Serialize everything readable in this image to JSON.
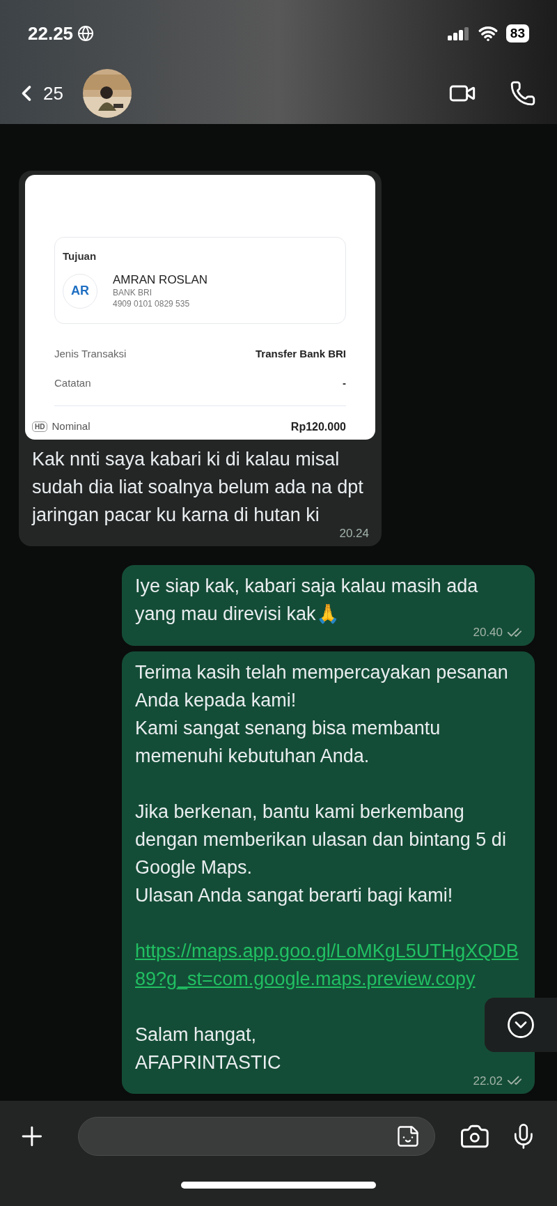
{
  "status_bar": {
    "time": "22.25",
    "battery": "83"
  },
  "header": {
    "back_count": "25"
  },
  "messages": [
    {
      "kind": "incoming_receipt",
      "receipt": {
        "section_title": "Tujuan",
        "initials": "AR",
        "name": "AMRAN ROSLAN",
        "bank": "BANK BRI",
        "account": "4909 0101 0829 535",
        "details": [
          {
            "label": "Jenis Transaksi",
            "value": "Transfer Bank BRI"
          },
          {
            "label": "Catatan",
            "value": "-"
          }
        ],
        "total": {
          "label": "Nominal",
          "value": "Rp120.000"
        },
        "badge": "HD"
      },
      "paragraphs": [
        {
          "kind": "text",
          "lines": [
            "Kak nnti saya kabari ki di kalau misal sudah dia liat soalnya belum ada na dpt jaringan pacar ku karna di hutan ki"
          ]
        }
      ],
      "time": "20.24"
    },
    {
      "kind": "outgoing_text",
      "paragraphs": [
        {
          "kind": "text",
          "lines": [
            "Iye siap kak, kabari saja kalau masih ada yang mau direvisi kak🙏"
          ]
        }
      ],
      "time": "20.40"
    },
    {
      "kind": "outgoing_text",
      "paragraphs": [
        {
          "kind": "text",
          "lines": [
            "Terima kasih telah mempercayakan pesanan Anda kepada kami!",
            "Kami sangat senang bisa membantu memenuhi kebutuhan Anda."
          ]
        },
        {
          "kind": "text",
          "lines": [
            "Jika berkenan, bantu kami berkembang dengan memberikan ulasan dan bintang 5 di Google Maps.",
            "Ulasan Anda sangat berarti bagi kami!"
          ]
        },
        {
          "kind": "link",
          "text": "https://maps.app.goo.gl/LoMKgL5UTHgXQDB89?g_st=com.google.maps.preview.copy"
        },
        {
          "kind": "text",
          "lines": [
            "Salam hangat,",
            "AFAPRINTASTIC"
          ]
        }
      ],
      "time": "22.02"
    }
  ]
}
